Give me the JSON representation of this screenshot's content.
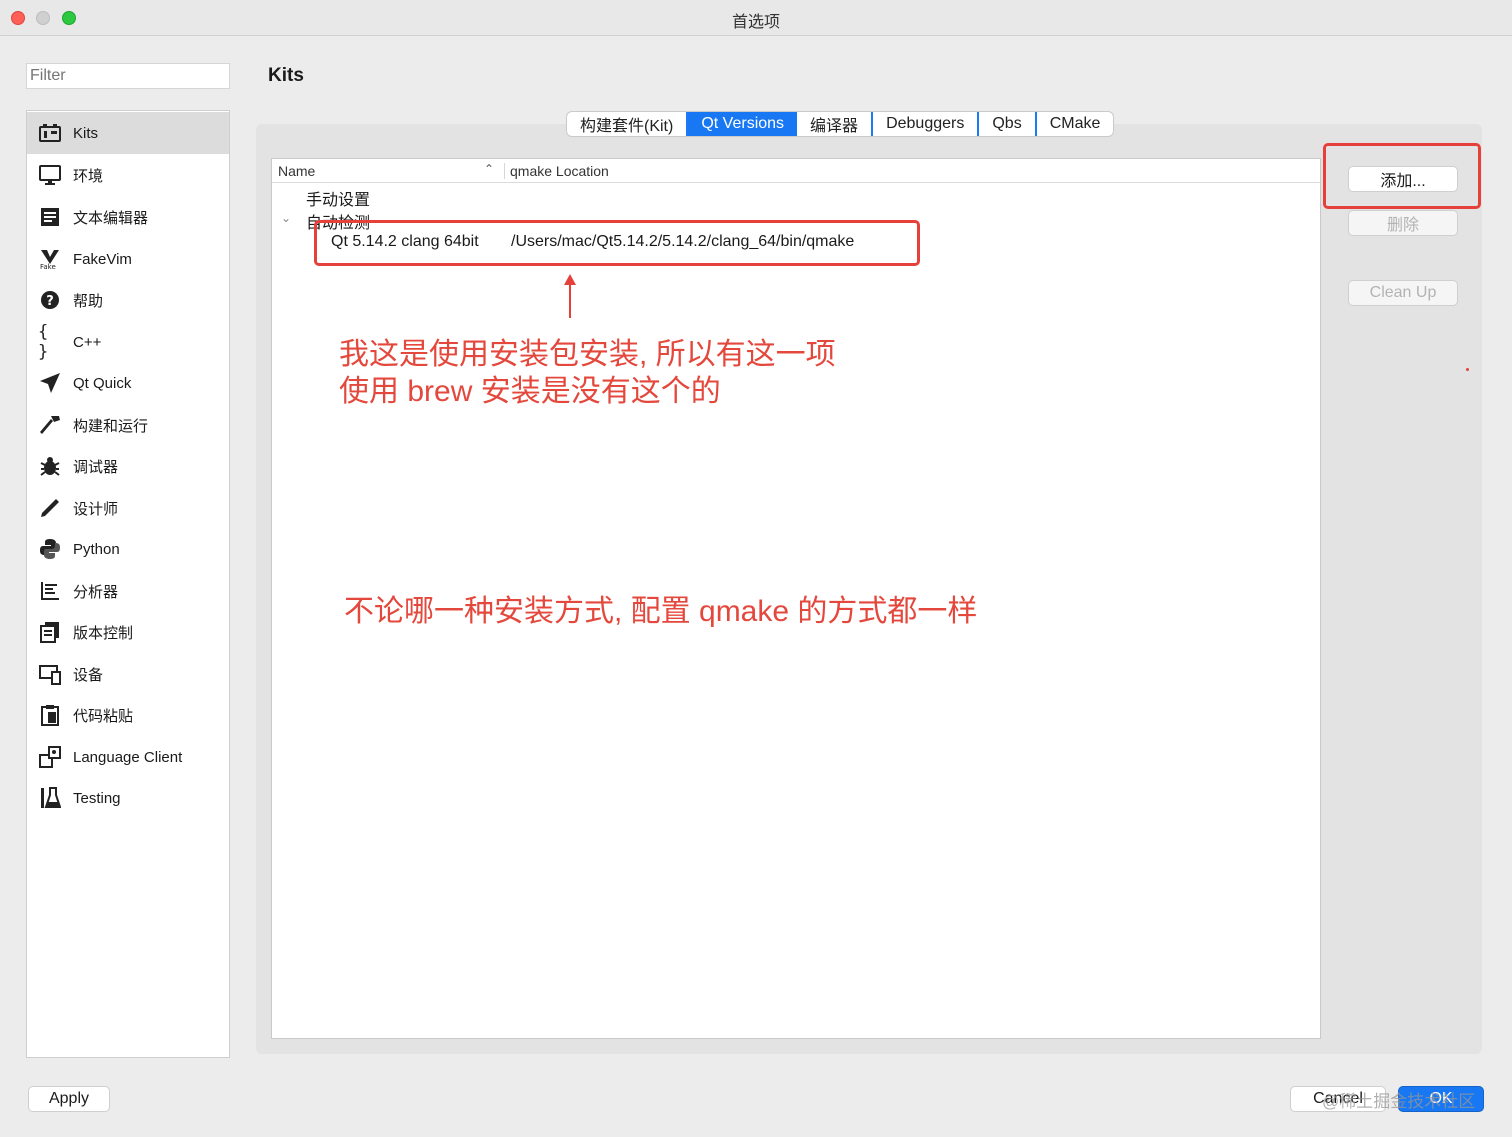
{
  "window": {
    "title": "首选项"
  },
  "filter": {
    "placeholder": "Filter"
  },
  "sidebar": {
    "items": [
      {
        "label": "Kits",
        "icon": "kits-icon",
        "selected": true
      },
      {
        "label": "环境",
        "icon": "monitor-icon"
      },
      {
        "label": "文本编辑器",
        "icon": "text-editor-icon"
      },
      {
        "label": "FakeVim",
        "icon": "fakevim-icon"
      },
      {
        "label": "帮助",
        "icon": "help-icon"
      },
      {
        "label": "C++",
        "icon": "braces-icon"
      },
      {
        "label": "Qt Quick",
        "icon": "paper-plane-icon"
      },
      {
        "label": "构建和运行",
        "icon": "hammer-icon"
      },
      {
        "label": "调试器",
        "icon": "bug-icon"
      },
      {
        "label": "设计师",
        "icon": "pencil-icon"
      },
      {
        "label": "Python",
        "icon": "python-icon"
      },
      {
        "label": "分析器",
        "icon": "analyzer-icon"
      },
      {
        "label": "版本控制",
        "icon": "version-control-icon"
      },
      {
        "label": "设备",
        "icon": "device-icon"
      },
      {
        "label": "代码粘贴",
        "icon": "clipboard-icon"
      },
      {
        "label": "Language Client",
        "icon": "language-client-icon"
      },
      {
        "label": "Testing",
        "icon": "flask-icon"
      }
    ]
  },
  "page": {
    "title": "Kits"
  },
  "tabs": [
    {
      "label": "构建套件(Kit)",
      "active": false
    },
    {
      "label": "Qt Versions",
      "active": true
    },
    {
      "label": "编译器",
      "active": false
    },
    {
      "label": "Debuggers",
      "active": false
    },
    {
      "label": "Qbs",
      "active": false
    },
    {
      "label": "CMake",
      "active": false
    }
  ],
  "table": {
    "columns": {
      "name": "Name",
      "location": "qmake Location"
    },
    "groups": {
      "manual": "手动设置",
      "auto": "自动检测"
    },
    "rows": [
      {
        "name": "Qt 5.14.2 clang 64bit",
        "location": "/Users/mac/Qt5.14.2/5.14.2/clang_64/bin/qmake"
      }
    ]
  },
  "side_buttons": {
    "add": "添加...",
    "remove": "删除",
    "cleanup": "Clean Up"
  },
  "footer": {
    "apply": "Apply",
    "cancel": "Cancel",
    "ok": "OK"
  },
  "annotations": {
    "note1_line1": "我这是使用安装包安装, 所以有这一项",
    "note1_line2": "使用 brew 安装是没有这个的",
    "note2": "不论哪一种安装方式, 配置 qmake 的方式都一样"
  },
  "watermark": "@稀土掘金技术社区",
  "colors": {
    "accent": "#1878f3",
    "annotation": "#e6403a"
  }
}
